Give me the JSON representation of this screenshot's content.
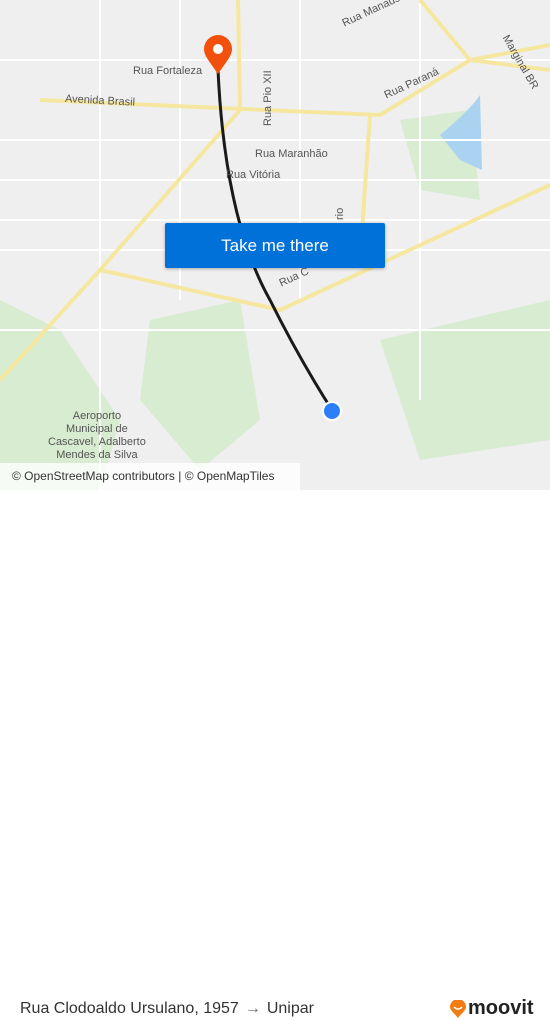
{
  "map": {
    "street_labels": [
      "Rua Manaus",
      "Marginal BR",
      "Rua Fortaleza",
      "Rua Pio XII",
      "Rua Paraná",
      "Avenida Brasil",
      "Rua Maranhão",
      "Rua Vitória",
      "Rua C",
      "rio"
    ],
    "poi_label": "Aeroporto\nMunicipal de\nCascavel, Adalberto\nMendes da Silva",
    "attribution": "© OpenStreetMap contributors | © OpenMapTiles",
    "route_color": "#1a1a1a",
    "origin_color": "#2d7ff9",
    "destination_color": "#f2500d"
  },
  "cta": {
    "label": "Take me there",
    "color": "#0071d9"
  },
  "footer": {
    "origin": "Rua Clodoaldo Ursulano, 1957",
    "arrow": "→",
    "destination": "Unipar",
    "brand": "moovit",
    "brand_color": "#f27c14"
  }
}
